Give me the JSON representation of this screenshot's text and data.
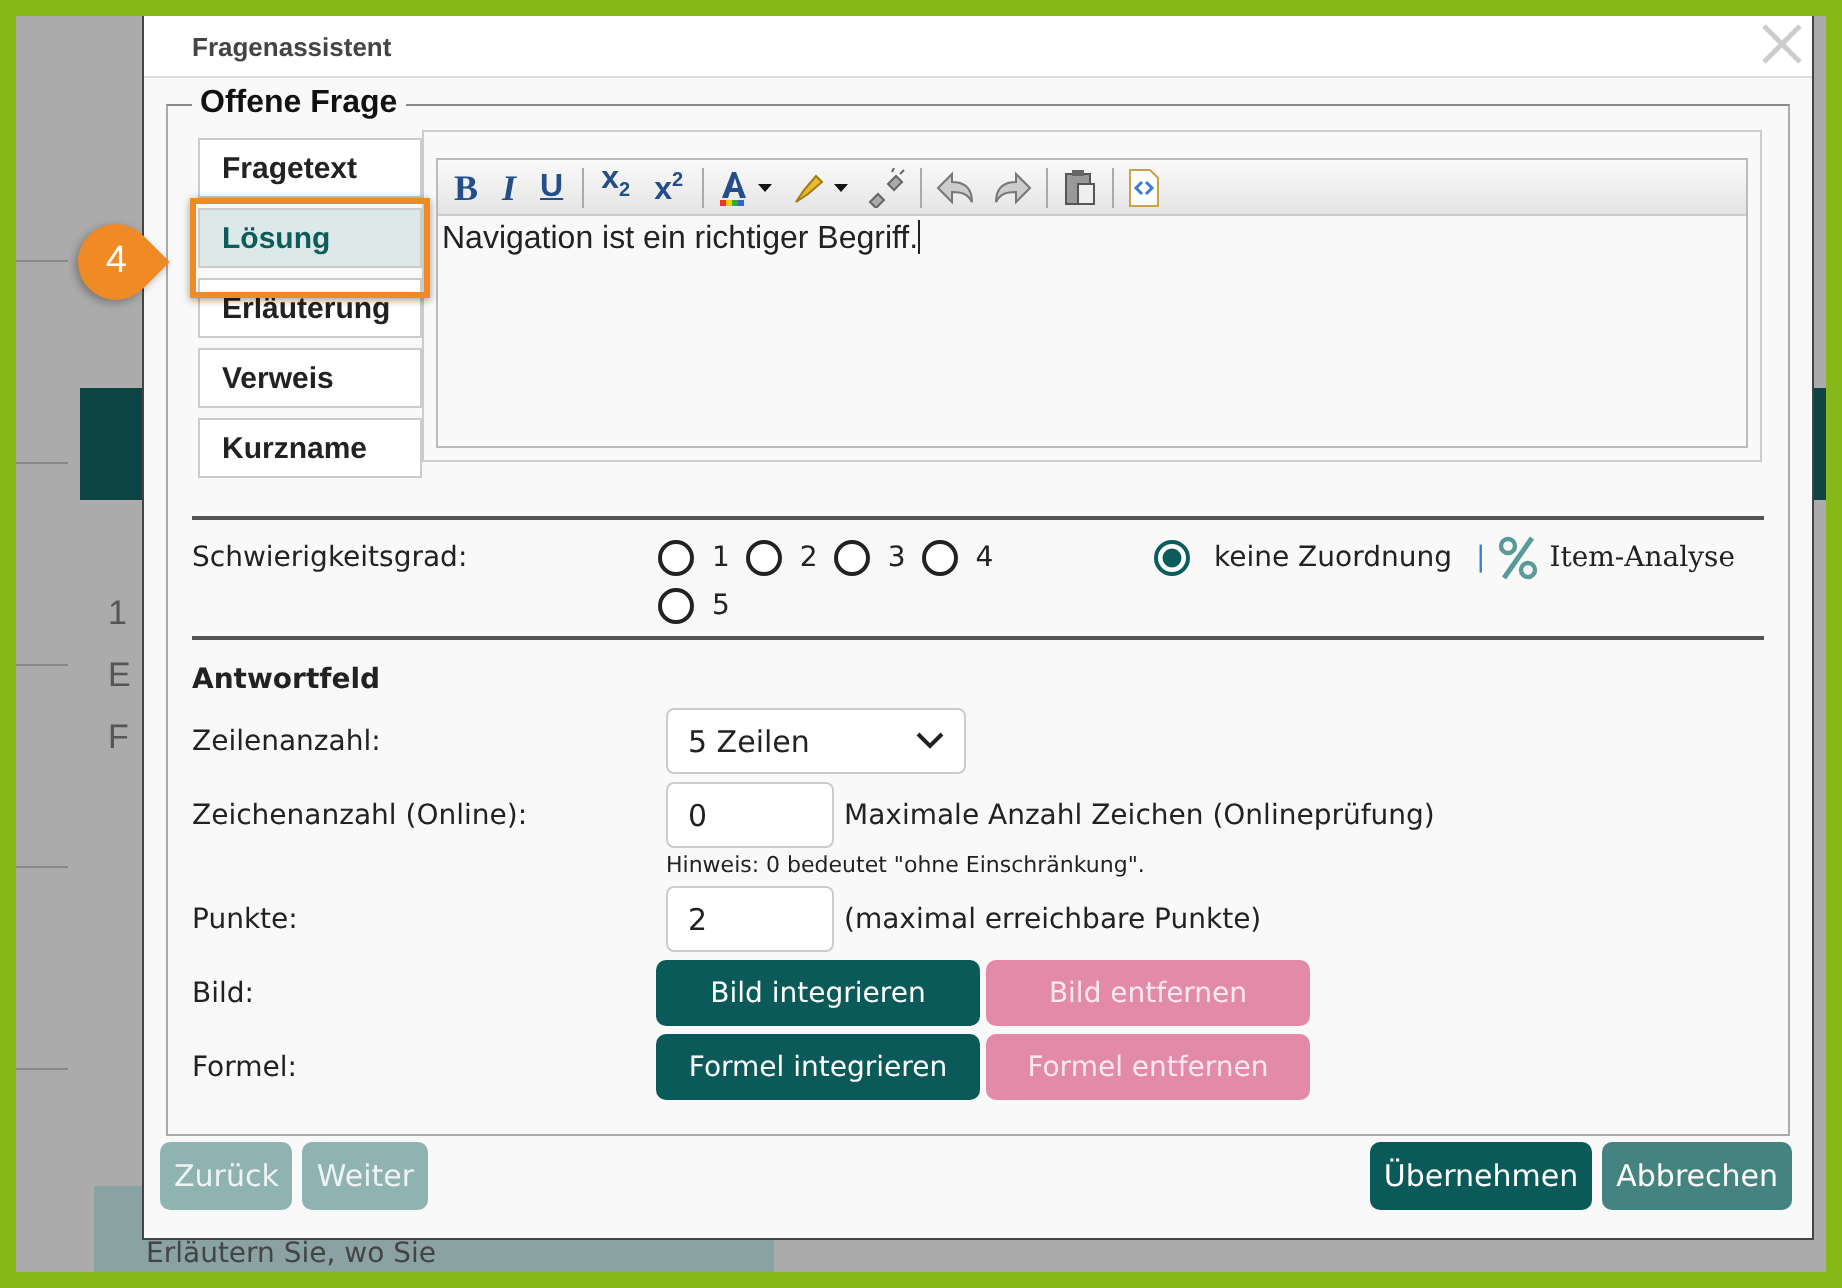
{
  "background": {
    "fragments": [
      "1",
      "E",
      "F"
    ],
    "panel_text": "Erläutern Sie, wo Sie"
  },
  "dialog": {
    "title": "Fragenassistent",
    "section": "Offene Frage"
  },
  "tabs": [
    {
      "label": "Fragetext",
      "selected": false
    },
    {
      "label": "Lösung",
      "selected": true
    },
    {
      "label": "Erläuterung",
      "selected": false
    },
    {
      "label": "Verweis",
      "selected": false
    },
    {
      "label": "Kurzname",
      "selected": false
    }
  ],
  "callout": {
    "number": "4"
  },
  "editor": {
    "toolbar": [
      {
        "kind": "bold",
        "label": "B"
      },
      {
        "kind": "italic",
        "label": "I"
      },
      {
        "kind": "underline",
        "label": "U"
      },
      {
        "kind": "separator"
      },
      {
        "kind": "subscript",
        "label": "x",
        "mark": "2"
      },
      {
        "kind": "superscript",
        "label": "x",
        "mark": "2"
      },
      {
        "kind": "separator"
      },
      {
        "kind": "text-color"
      },
      {
        "kind": "highlight"
      },
      {
        "kind": "unlink"
      },
      {
        "kind": "separator"
      },
      {
        "kind": "undo"
      },
      {
        "kind": "redo"
      },
      {
        "kind": "separator"
      },
      {
        "kind": "paste"
      },
      {
        "kind": "separator"
      },
      {
        "kind": "source"
      }
    ],
    "text": "Navigation ist ein richtiger Begriff."
  },
  "difficulty": {
    "label": "Schwierigkeitsgrad:",
    "options": [
      {
        "kind": "level",
        "label": "1",
        "selected": false
      },
      {
        "kind": "level",
        "label": "2",
        "selected": false
      },
      {
        "kind": "level",
        "label": "3",
        "selected": false
      },
      {
        "kind": "level",
        "label": "4",
        "selected": false
      },
      {
        "kind": "none",
        "label": "keine Zuordnung",
        "selected": true
      },
      {
        "kind": "level",
        "label": "5",
        "selected": false
      }
    ],
    "separator": "|",
    "link": "Item-Analyse"
  },
  "answer": {
    "title": "Antwortfeld",
    "rows": {
      "label": "Zeilenanzahl:",
      "value": "5 Zeilen"
    },
    "chars": {
      "label": "Zeichenanzahl (Online):",
      "value": "0",
      "note": "Maximale Anzahl Zeichen (Onlineprüfung)",
      "hint": "Hinweis: 0 bedeutet \"ohne Einschränkung\"."
    },
    "points": {
      "label": "Punkte:",
      "value": "2",
      "note": "(maximal erreichbare Punkte)"
    },
    "image": {
      "label": "Bild:",
      "buttons": [
        {
          "label": "Bild integrieren",
          "kind": "primary"
        },
        {
          "label": "Bild entfernen",
          "kind": "danger"
        }
      ]
    },
    "formula": {
      "label": "Formel:",
      "buttons": [
        {
          "label": "Formel integrieren",
          "kind": "primary"
        },
        {
          "label": "Formel entfernen",
          "kind": "danger"
        }
      ]
    }
  },
  "footer": {
    "left": [
      {
        "label": "Zurück",
        "disabled": true
      },
      {
        "label": "Weiter",
        "disabled": true
      }
    ],
    "right": [
      {
        "label": "Übernehmen",
        "kind": "primary"
      },
      {
        "label": "Abbrechen",
        "kind": "secondary"
      }
    ]
  }
}
